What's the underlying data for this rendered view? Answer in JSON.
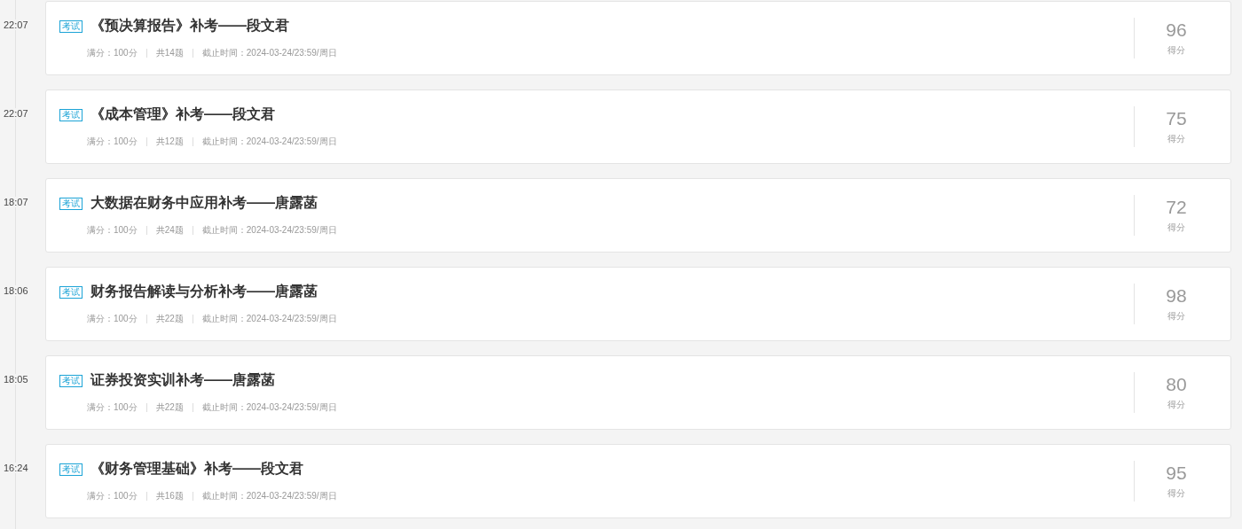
{
  "exams": [
    {
      "time": "22:07",
      "tag": "考试",
      "title": "《预决算报告》补考——段文君",
      "full_score": "满分：100分",
      "questions": "共14题",
      "deadline": "截止时间：2024-03-24/23:59/周日",
      "score": "96",
      "score_label": "得分"
    },
    {
      "time": "22:07",
      "tag": "考试",
      "title": "《成本管理》补考——段文君",
      "full_score": "满分：100分",
      "questions": "共12题",
      "deadline": "截止时间：2024-03-24/23:59/周日",
      "score": "75",
      "score_label": "得分"
    },
    {
      "time": "18:07",
      "tag": "考试",
      "title": "大数据在财务中应用补考——唐露菡",
      "full_score": "满分：100分",
      "questions": "共24题",
      "deadline": "截止时间：2024-03-24/23:59/周日",
      "score": "72",
      "score_label": "得分"
    },
    {
      "time": "18:06",
      "tag": "考试",
      "title": "财务报告解读与分析补考——唐露菡",
      "full_score": "满分：100分",
      "questions": "共22题",
      "deadline": "截止时间：2024-03-24/23:59/周日",
      "score": "98",
      "score_label": "得分"
    },
    {
      "time": "18:05",
      "tag": "考试",
      "title": "证券投资实训补考——唐露菡",
      "full_score": "满分：100分",
      "questions": "共22题",
      "deadline": "截止时间：2024-03-24/23:59/周日",
      "score": "80",
      "score_label": "得分"
    },
    {
      "time": "16:24",
      "tag": "考试",
      "title": "《财务管理基础》补考——段文君",
      "full_score": "满分：100分",
      "questions": "共16题",
      "deadline": "截止时间：2024-03-24/23:59/周日",
      "score": "95",
      "score_label": "得分"
    }
  ]
}
